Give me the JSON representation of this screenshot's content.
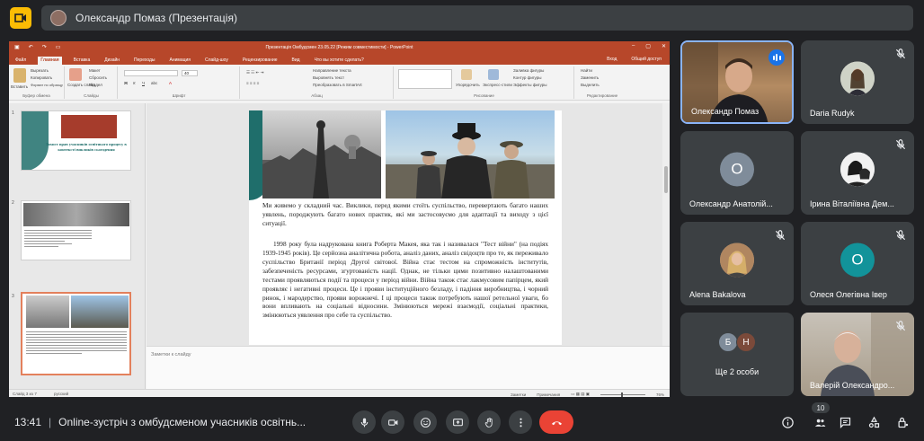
{
  "header": {
    "presenter_label": "Олександр Помаз (Презентація)"
  },
  "ppt": {
    "window_title": "Презентація Омбудсмен 23.05.22 [Режим совместимости] - PowerPoint",
    "menu_tabs": [
      "Файл",
      "Главная",
      "Вставка",
      "Дизайн",
      "Переходы",
      "Анимация",
      "Слайд-шоу",
      "Рецензирование",
      "Вид",
      "Что вы хотите сделать?"
    ],
    "menu_right": [
      "Вход",
      "Общий доступ"
    ],
    "ribbon": {
      "paste": "Вставить",
      "cut": "Вырезать",
      "copy": "Копировать",
      "format_painter": "Формат по образцу",
      "new_slide": "Создать слайд",
      "layout": "Макет",
      "reset": "Сбросить",
      "section": "Раздел",
      "font_size": "40",
      "text_direction": "Направление текста",
      "align_text": "Выровнять текст",
      "smartart": "Преобразовать в SmartArt",
      "arrange": "Упорядочить",
      "quick_styles": "Экспресс-стили",
      "shape_fill": "Заливка фигуры",
      "shape_outline": "Контур фигуры",
      "shape_effects": "Эффекты фигуры",
      "find": "Найти",
      "replace": "Заменить",
      "select": "Выделить",
      "groups": [
        "Буфер обмена",
        "Слайды",
        "Шрифт",
        "Абзац",
        "Рисование",
        "Редактирование"
      ]
    },
    "thumbnails": [
      {
        "num": "1",
        "title": "Захист прав учасників освітнього процесу в контексті викликів сьогодення"
      },
      {
        "num": "2",
        "title": ""
      },
      {
        "num": "3",
        "title": ""
      }
    ],
    "slide": {
      "para1": "Ми живемо у складний час. Виклики, перед якими стоїть суспільство, перевертають багато наших уявлень, породжують багато нових практик, які ми застосовуємо для адаптації та виходу з цієї ситуації.",
      "para2": "1998 року була надрукована книга Роберта Макея, яка так і називалася \"Тест війни\" (на подіях 1939-1945 років). Це серйозна аналітична робота, аналіз даних, аналіз свідоцтв про те, як переживало суспільство Британії період Другої світової. Війна стає тестом на спроможність інститутів, забезпеченість ресурсами, згуртованість нації. Однак, не тільки цими позитивно налаштованими тестами проявляються події та процеси у період війни. Війна також стає лакмусовим папірцем, який проявляє і негативні процеси. Це і прояви інституційного безладу, і падіння виробництва, і чорний ринок, і мародерство, прояви ворожнечі. І ці процеси також потребують нашої ретельної уваги, бо вони впливають на соціальні відносини. Змінюються мережі взаємодії, соціальні практики, змінюються уявлення про себе та суспільство."
    },
    "notes_placeholder": "Заметки к слайду",
    "status": {
      "slide_of": "Слайд 3 из 7",
      "language": "русский",
      "notes": "Заметки",
      "comments": "Примечания",
      "zoom": "76%"
    }
  },
  "participants": [
    {
      "name": "Олександр Помаз",
      "type": "video",
      "speaking": true
    },
    {
      "name": "Daria Rudyk",
      "type": "photo",
      "muted": true
    },
    {
      "name": "Олександр Анатолій...",
      "type": "letter",
      "letter": "О",
      "color": "#7f8c9a",
      "muted": false
    },
    {
      "name": "Ірина Віталіївна Дем...",
      "type": "photo",
      "muted": true
    },
    {
      "name": "Alena Bakalova",
      "type": "photo",
      "muted": true
    },
    {
      "name": "Олеся Олегівна Івер",
      "type": "letter",
      "letter": "О",
      "color": "#12939a",
      "muted": true
    },
    {
      "name": "Ще 2 особи",
      "type": "group",
      "letters": [
        "Б",
        "Н"
      ],
      "colors": [
        "#7f8c9a",
        "#7b4a3a"
      ]
    },
    {
      "name": "Валерій Олександро...",
      "type": "video",
      "muted": true
    }
  ],
  "bottom": {
    "time": "13:41",
    "meeting_title": "Online-зустріч з омбудсменом учасників освітнь...",
    "participant_count": "10"
  },
  "colors": {
    "ppt_red": "#b7472a",
    "end_call": "#ea4335",
    "accent_blue": "#8ab4f8",
    "meet_yellow": "#fbbc04"
  }
}
